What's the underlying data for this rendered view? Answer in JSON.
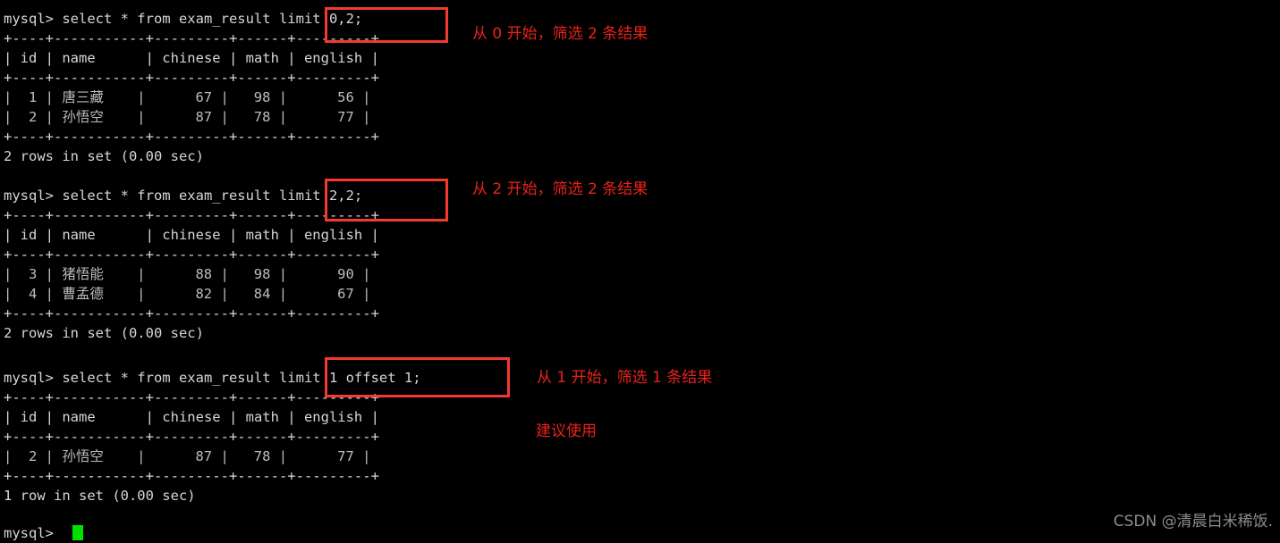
{
  "terminal": {
    "prompt": "mysql> ",
    "background_color": "#000000",
    "text_color": "#d6d6d6",
    "cursor_color": "#00e000",
    "annotation_color": "#e8221b",
    "box_color": "#f23a30"
  },
  "blocks": [
    {
      "command": "mysql> select * from exam_result limit 0,2;",
      "command_prefix": "mysql> select * from exam_result ",
      "highlight": "limit 0,2;",
      "sep_top": "+----+-----------+---------+------+---------+",
      "header": "| id | name      | chinese | math | english |",
      "sep_mid": "+----+-----------+---------+------+---------+",
      "rows": [
        "|  1 | 唐三藏    |      67 |   98 |      56 |",
        "|  2 | 孙悟空    |      87 |   78 |      77 |"
      ],
      "sep_bot": "+----+-----------+---------+------+---------+",
      "status": "2 rows in set (0.00 sec)",
      "annotation": "从 0 开始，筛选 2 条结果"
    },
    {
      "command": "mysql> select * from exam_result limit 2,2;",
      "command_prefix": "mysql> select * from exam_result ",
      "highlight": "limit 2,2;",
      "sep_top": "+----+-----------+---------+------+---------+",
      "header": "| id | name      | chinese | math | english |",
      "sep_mid": "+----+-----------+---------+------+---------+",
      "rows": [
        "|  3 | 猪悟能    |      88 |   98 |      90 |",
        "|  4 | 曹孟德    |      82 |   84 |      67 |"
      ],
      "sep_bot": "+----+-----------+---------+------+---------+",
      "status": "2 rows in set (0.00 sec)",
      "annotation": "从 2 开始，筛选 2 条结果"
    },
    {
      "command": "mysql> select * from exam_result limit 1 offset 1;",
      "command_prefix": "mysql> select * from exam_result ",
      "highlight": "limit 1 offset 1;",
      "sep_top": "+----+-----------+---------+------+---------+",
      "header": "| id | name      | chinese | math | english |",
      "sep_mid": "+----+-----------+---------+------+---------+",
      "rows": [
        "|  2 | 孙悟空    |      87 |   78 |      77 |"
      ],
      "sep_bot": "+----+-----------+---------+------+---------+",
      "status": "1 row in set (0.00 sec)",
      "annotation": "从 1 开始，筛选 1 条结果",
      "annotation2": "建议使用"
    }
  ],
  "final_prompt": "mysql> ",
  "watermark": "CSDN @清晨白米稀饭.",
  "table_columns": [
    "id",
    "name",
    "chinese",
    "math",
    "english"
  ],
  "table_data": [
    {
      "id": 1,
      "name": "唐三藏",
      "chinese": 67,
      "math": 98,
      "english": 56
    },
    {
      "id": 2,
      "name": "孙悟空",
      "chinese": 87,
      "math": 78,
      "english": 77
    },
    {
      "id": 3,
      "name": "猪悟能",
      "chinese": 88,
      "math": 98,
      "english": 90
    },
    {
      "id": 4,
      "name": "曹孟德",
      "chinese": 82,
      "math": 84,
      "english": 67
    }
  ]
}
